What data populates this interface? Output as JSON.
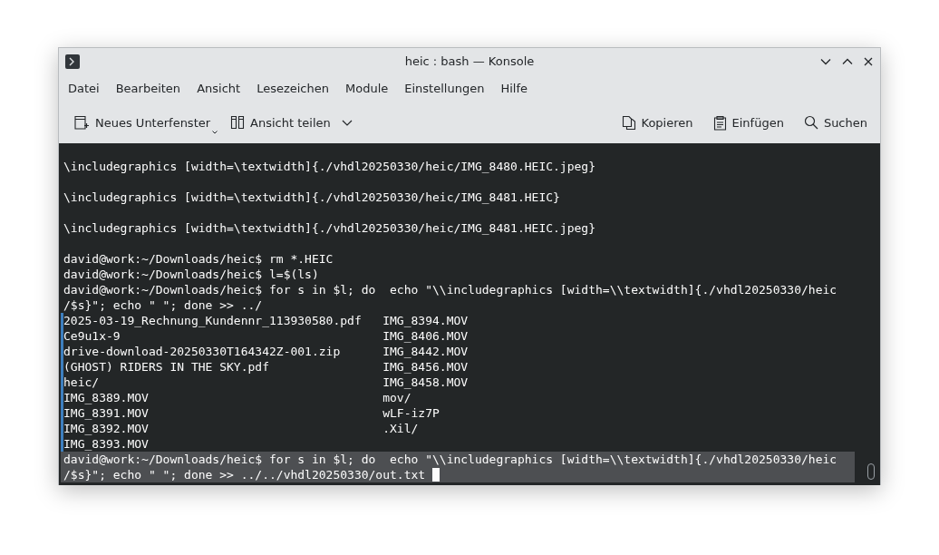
{
  "window": {
    "title": "heic : bash — Konsole"
  },
  "menu": [
    {
      "label": "Datei"
    },
    {
      "label": "Bearbeiten"
    },
    {
      "label": "Ansicht"
    },
    {
      "label": "Lesezeichen"
    },
    {
      "label": "Module"
    },
    {
      "label": "Einstellungen"
    },
    {
      "label": "Hilfe"
    }
  ],
  "toolbar": {
    "left": [
      {
        "label": "Neues Unterfenster",
        "kind": "new-tab"
      },
      {
        "label": "Ansicht teilen",
        "kind": "split"
      }
    ],
    "right": [
      {
        "label": "Kopieren",
        "kind": "copy"
      },
      {
        "label": "Einfügen",
        "kind": "paste"
      },
      {
        "label": "Suchen",
        "kind": "search"
      }
    ]
  },
  "terminal": {
    "lines": [
      {
        "kind": "blank"
      },
      {
        "kind": "text",
        "text": "\\includegraphics [width=\\textwidth]{./vhdl20250330/heic/IMG_8480.HEIC.jpeg}"
      },
      {
        "kind": "blank"
      },
      {
        "kind": "text",
        "text": "\\includegraphics [width=\\textwidth]{./vhdl20250330/heic/IMG_8481.HEIC}"
      },
      {
        "kind": "blank"
      },
      {
        "kind": "text",
        "text": "\\includegraphics [width=\\textwidth]{./vhdl20250330/heic/IMG_8481.HEIC.jpeg}"
      },
      {
        "kind": "blank"
      },
      {
        "kind": "text",
        "text": "david@work:~/Downloads/heic$ rm *.HEIC"
      },
      {
        "kind": "text",
        "text": "david@work:~/Downloads/heic$ l=$(ls)"
      },
      {
        "kind": "text",
        "text": "david@work:~/Downloads/heic$ for s in $l; do  echo \"\\\\includegraphics [width=\\\\textwidth]{./vhdl20250330/heic"
      },
      {
        "kind": "text",
        "text": "/$s}\"; echo \" \"; done >> ../"
      },
      {
        "kind": "columns",
        "marked": true,
        "cells": [
          "2025-03-19_Rechnung_Kundennr_113930580.pdf",
          "IMG_8394.MOV"
        ]
      },
      {
        "kind": "columns",
        "marked": true,
        "cells": [
          "Ce9u1x-9",
          "IMG_8406.MOV"
        ]
      },
      {
        "kind": "columns",
        "marked": true,
        "cells": [
          "drive-download-20250330T164342Z-001.zip",
          "IMG_8442.MOV"
        ]
      },
      {
        "kind": "columns",
        "marked": true,
        "cells": [
          "(GHOST) RIDERS IN THE SKY.pdf",
          "IMG_8456.MOV"
        ]
      },
      {
        "kind": "columns",
        "marked": true,
        "cells": [
          "heic/",
          "IMG_8458.MOV"
        ]
      },
      {
        "kind": "columns",
        "marked": true,
        "cells": [
          "IMG_8389.MOV",
          "mov/"
        ]
      },
      {
        "kind": "columns",
        "marked": true,
        "cells": [
          "IMG_8391.MOV",
          "wLF-iz7P"
        ]
      },
      {
        "kind": "columns",
        "marked": true,
        "cells": [
          "IMG_8392.MOV",
          ".Xil/"
        ]
      },
      {
        "kind": "columns",
        "marked": true,
        "cells": [
          "IMG_8393.MOV"
        ]
      },
      {
        "kind": "text",
        "highlighted": true,
        "text": "david@work:~/Downloads/heic$ for s in $l; do  echo \"\\\\includegraphics [width=\\\\textwidth]{./vhdl20250330/heic"
      },
      {
        "kind": "text",
        "highlighted": true,
        "cursor": true,
        "text": "/$s}\"; echo \" \"; done >> ../../vhdl20250330/out.txt"
      }
    ]
  }
}
